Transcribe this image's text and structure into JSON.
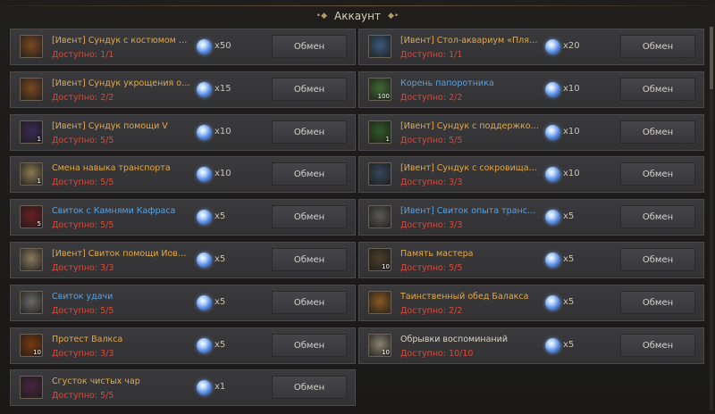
{
  "header": {
    "title": "Аккаунт"
  },
  "colors": {
    "gold": "#e2a84a",
    "blue": "#5aa0e0",
    "white": "#d8d4c8",
    "red": "#d44a3c"
  },
  "button_label": "Обмен",
  "items": [
    {
      "name": "[Ивент] Сундук с костюмом Летн...",
      "available": "Доступно: 1/1",
      "cost": "x50",
      "color": "#e2a84a",
      "icon": "chest-icon",
      "icon_bg": "#7a4a22",
      "icon_count": "",
      "col": 0,
      "row": 0
    },
    {
      "name": "[Ивент] Стол-аквариум «Пляж Т...",
      "available": "Доступно: 1/1",
      "cost": "x20",
      "color": "#e2a84a",
      "icon": "aquarium-icon",
      "icon_bg": "#3a5a7a",
      "icon_count": "",
      "col": 1,
      "row": 0
    },
    {
      "name": "[Ивент] Сундук укрощения от Гу...",
      "available": "Доступно: 2/2",
      "cost": "x15",
      "color": "#e2a84a",
      "icon": "chest-icon",
      "icon_bg": "#7a4a22",
      "icon_count": "",
      "col": 0,
      "row": 1
    },
    {
      "name": "Корень папоротника",
      "available": "Доступно: 2/2",
      "cost": "x10",
      "color": "#5aa0e0",
      "icon": "fern-root-icon",
      "icon_bg": "#3f6a34",
      "icon_count": "100",
      "col": 1,
      "row": 1
    },
    {
      "name": "[Ивент] Сундук помощи V",
      "available": "Доступно: 5/5",
      "cost": "x10",
      "color": "#e2a84a",
      "icon": "purple-box-icon",
      "icon_bg": "#3a2a55",
      "icon_count": "1",
      "col": 0,
      "row": 2
    },
    {
      "name": "[Ивент] Сундук с поддержкой III",
      "available": "Доступно: 5/5",
      "cost": "x10",
      "color": "#e2a84a",
      "icon": "green-box-icon",
      "icon_bg": "#2f5a2a",
      "icon_count": "1",
      "col": 1,
      "row": 2
    },
    {
      "name": "Смена навыка транспорта",
      "available": "Доступно: 5/5",
      "cost": "x10",
      "color": "#e2a84a",
      "icon": "horse-skill-icon",
      "icon_bg": "#8a7a52",
      "icon_count": "1",
      "col": 0,
      "row": 3
    },
    {
      "name": "[Ивент] Сундук с сокровищами Т...",
      "available": "Доступно: 3/3",
      "cost": "x10",
      "color": "#e2a84a",
      "icon": "treasure-chest-icon",
      "icon_bg": "#33475c",
      "icon_count": "",
      "col": 1,
      "row": 3
    },
    {
      "name": "Свиток с Камнями Кафраса",
      "available": "Доступно: 5/5",
      "cost": "x5",
      "color": "#5aa0e0",
      "icon": "red-stone-icon",
      "icon_bg": "#6a1e24",
      "icon_count": "5",
      "col": 0,
      "row": 4
    },
    {
      "name": "[Ивент] Свиток опыта транспорт...",
      "available": "Доступно: 3/3",
      "cost": "x5",
      "color": "#5aa0e0",
      "icon": "scroll-icon",
      "icon_bg": "#5a5a5a",
      "icon_count": "",
      "col": 1,
      "row": 4
    },
    {
      "name": "[Ивент] Свиток помощи Йована ...",
      "available": "Доступно: 3/3",
      "cost": "x5",
      "color": "#e2a84a",
      "icon": "paper-icon",
      "icon_bg": "#8a7a62",
      "icon_count": "",
      "col": 0,
      "row": 5
    },
    {
      "name": "Память мастера",
      "available": "Доступно: 5/5",
      "cost": "x5",
      "color": "#e2a84a",
      "icon": "master-memory-icon",
      "icon_bg": "#4a3e2a",
      "icon_count": "10",
      "col": 1,
      "row": 5
    },
    {
      "name": "Свиток удачи",
      "available": "Доступно: 5/5",
      "cost": "x5",
      "color": "#5aa0e0",
      "icon": "luck-scroll-icon",
      "icon_bg": "#6a6a6a",
      "icon_count": "",
      "col": 0,
      "row": 6
    },
    {
      "name": "Таинственный обед Балакса",
      "available": "Доступно: 2/2",
      "cost": "x5",
      "color": "#e2a84a",
      "icon": "food-icon",
      "icon_bg": "#8a5a22",
      "icon_count": "",
      "col": 1,
      "row": 6
    },
    {
      "name": "Протест Валкса",
      "available": "Доступно: 3/3",
      "cost": "x5",
      "color": "#e2a84a",
      "icon": "valks-cry-icon",
      "icon_bg": "#7a3a10",
      "icon_count": "10",
      "col": 0,
      "row": 7
    },
    {
      "name": "Обрывки воспоминаний",
      "available": "Доступно: 10/10",
      "cost": "x5",
      "color": "#d8d4c8",
      "icon": "memory-fragment-icon",
      "icon_bg": "#8a8270",
      "icon_count": "10",
      "col": 1,
      "row": 7
    },
    {
      "name": "Сгусток чистых чар",
      "available": "Доступно: 5/5",
      "cost": "x1",
      "color": "#e2a84a",
      "icon": "magic-crystal-icon",
      "icon_bg": "#4a2440",
      "icon_count": "",
      "col": 0,
      "row": 8
    }
  ]
}
